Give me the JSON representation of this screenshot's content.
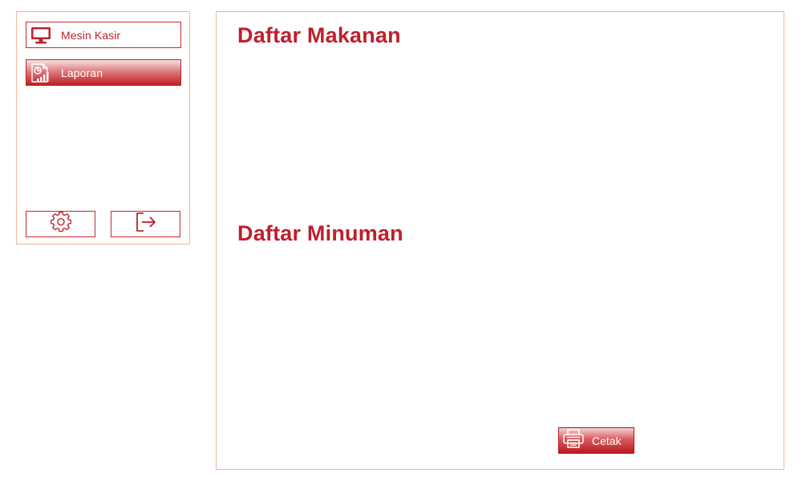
{
  "sidebar": {
    "items": [
      {
        "label": "Mesin Kasir",
        "icon": "monitor-icon",
        "active": false
      },
      {
        "label": "Laporan",
        "icon": "report-chart-icon",
        "active": true
      }
    ],
    "actions": [
      {
        "icon": "gear-icon"
      },
      {
        "icon": "logout-icon"
      }
    ]
  },
  "main": {
    "food_title": "Daftar Makanan",
    "drink_title": "Daftar Minuman",
    "print_label": "Cetak",
    "print_icon": "printer-icon"
  },
  "colors": {
    "accent": "#bf1e2d",
    "panel_border": "#f4b49c"
  }
}
